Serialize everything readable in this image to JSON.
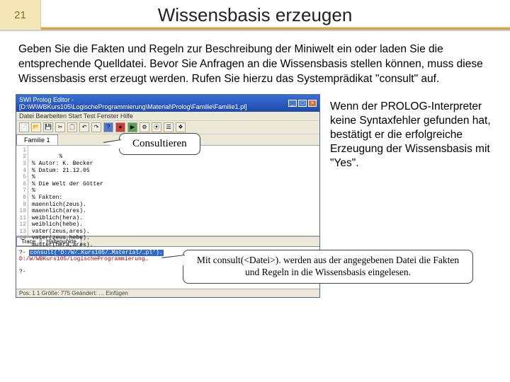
{
  "slide": {
    "number": "21",
    "title": "Wissensbasis erzeugen",
    "body": "Geben Sie die Fakten und Regeln zur Beschreibung der Miniwelt ein oder laden Sie die entsprechende Quelldatei. Bevor Sie Anfragen an die Wissensbasis stellen können, muss diese Wissensbasis erst erzeugt werden. Rufen Sie hierzu das Systemprädikat \"consult\" auf.",
    "side": "Wenn der PROLOG-Interpreter keine Syntaxfehler gefunden hat, bestätigt er die erfolgreiche Erzeugung der Wissensbasis mit \"Yes\"."
  },
  "callout1": "Consultieren",
  "callout2": "Mit consult(<Datei>). werden aus der angegebenen Datei die Fakten und Regeln in die Wissensbasis eingelesen.",
  "win": {
    "title": "SWI Prolog Editor - [D:\\W\\WBKurs105\\LogischeProgrammierung\\Material\\Prolog\\Familie\\Familie1.pl]",
    "menu": "Datei  Bearbeiten  Start  Test  Fenster  Hilfe",
    "tab": "Familie 1",
    "tabs2a": "Trace",
    "tabs2b": "Haltepunkte",
    "code": "%\n% Autor: K. Becker\n% Datum: 21.12.05\n%\n% Die Welt der Götter\n%\n% Fakten:\nmaennlich(zeus).\nmaennlich(ares).\nweiblich(hera).\nweiblich(hebe).\nvater(zeus,ares).\nvater(zeus,hebe).\nmutter(hera,ares).",
    "console_line1": "consult('D:/W/…Kurs105/…Material/…pl').",
    "console_line2": "D:/W/WBKurs105/LogischeProgrammierung…",
    "console_prompt": "?-",
    "status": "Pos: 1 1     Größe: 775     Geändert: …                     Einfügen"
  }
}
